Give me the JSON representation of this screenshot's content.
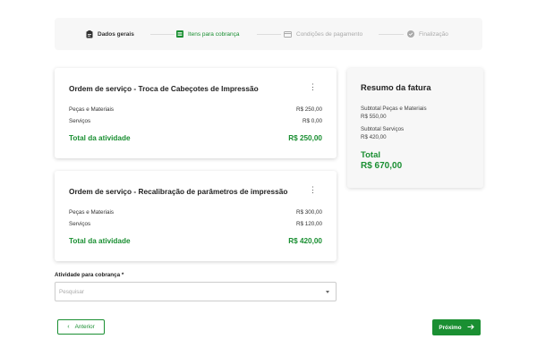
{
  "stepper": {
    "steps": [
      {
        "label": "Dados gerais",
        "icon": "clipboard-icon",
        "state": "done"
      },
      {
        "label": "Itens para cobrança",
        "icon": "list-icon",
        "state": "active"
      },
      {
        "label": "Condições de pagamento",
        "icon": "credit-card-icon",
        "state": "pending"
      },
      {
        "label": "Finalização",
        "icon": "check-circle-icon",
        "state": "pending"
      }
    ]
  },
  "orders": [
    {
      "title": "Ordem de serviço - Troca de Cabeçotes de Impressão",
      "lines": [
        {
          "label": "Peças e Materiais",
          "value": "R$ 250,00"
        },
        {
          "label": "Serviços",
          "value": "R$ 0,00"
        }
      ],
      "total_label": "Total da atividade",
      "total_value": "R$ 250,00"
    },
    {
      "title": "Ordem de serviço - Recalibração de parâmetros de impressão",
      "lines": [
        {
          "label": "Peças e Materiais",
          "value": "R$ 300,00"
        },
        {
          "label": "Serviços",
          "value": "R$ 120,00"
        }
      ],
      "total_label": "Total da atividade",
      "total_value": "R$ 420,00"
    }
  ],
  "summary": {
    "title": "Resumo da fatura",
    "parts_label": "Subtotal Peças e Materiais",
    "parts_value": "R$ 550,00",
    "services_label": "Subtotal Serviços",
    "services_value": "R$ 420,00",
    "total_label": "Total",
    "total_value": "R$ 670,00"
  },
  "activity_field": {
    "label": "Atividade para cobrança *",
    "placeholder": "Pesquisar"
  },
  "buttons": {
    "prev": "Anterior",
    "next": "Próximo"
  },
  "colors": {
    "accent": "#1a8f32",
    "muted": "#aaaaaa",
    "panel": "#f7f7f7"
  }
}
